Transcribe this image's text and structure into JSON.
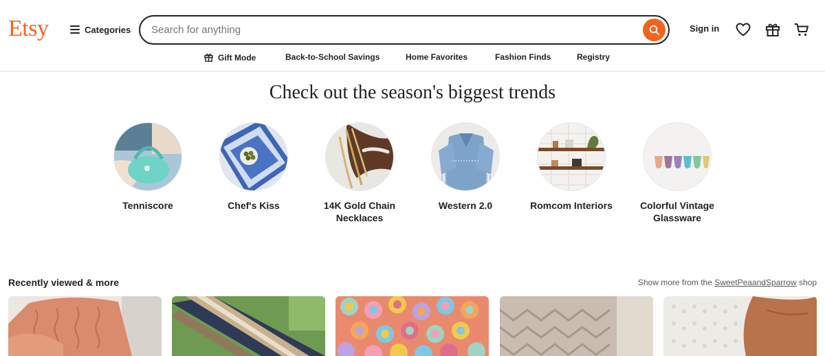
{
  "header": {
    "logo": "Etsy",
    "categories_label": "Categories",
    "search_placeholder": "Search for anything",
    "signin_label": "Sign in",
    "icons": [
      "heart-icon",
      "gift-icon",
      "cart-icon"
    ]
  },
  "nav": {
    "items": [
      {
        "label": "Gift Mode",
        "icon": "gift-icon"
      },
      {
        "label": "Back-to-School Savings"
      },
      {
        "label": "Home Favorites"
      },
      {
        "label": "Fashion Finds"
      },
      {
        "label": "Registry"
      }
    ]
  },
  "trends": {
    "title": "Check out the season's biggest trends",
    "items": [
      {
        "label": "Tenniscore"
      },
      {
        "label": "Chef's Kiss"
      },
      {
        "label": "14K Gold Chain Necklaces"
      },
      {
        "label": "Western 2.0"
      },
      {
        "label": "Romcom Interiors"
      },
      {
        "label": "Colorful Vintage Glassware"
      }
    ]
  },
  "recent": {
    "title": "Recently viewed & more",
    "more_prefix": "Show more from the ",
    "shop_name": "SweetPeaandSparrow",
    "more_suffix": " shop"
  },
  "colors": {
    "brand": "#f1641e",
    "text": "#222222",
    "muted": "#595959",
    "divider": "#e1e3df"
  }
}
